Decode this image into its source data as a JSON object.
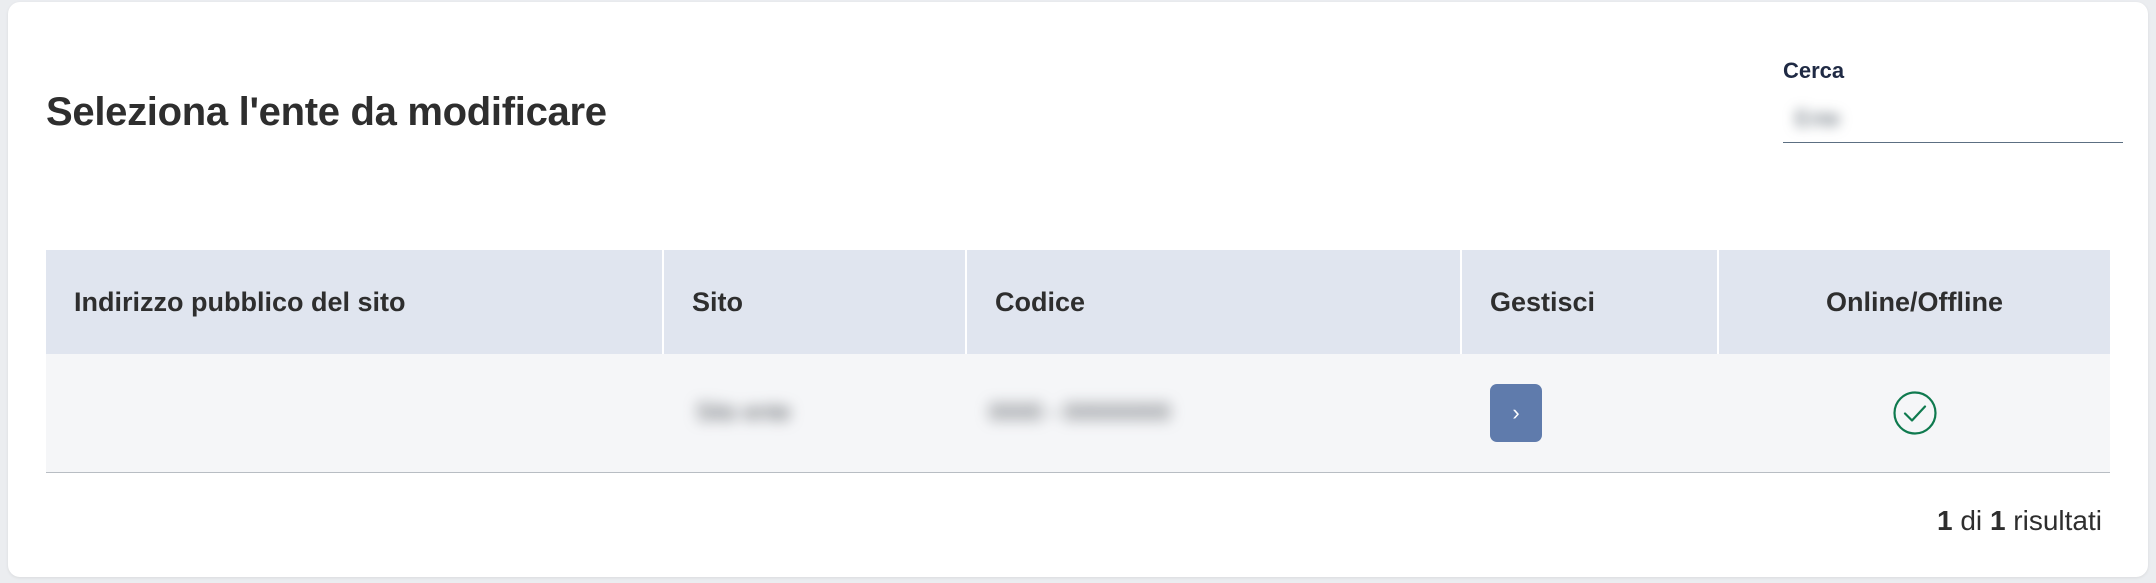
{
  "page": {
    "title": "Seleziona l'ente da modificare"
  },
  "search": {
    "label": "Cerca",
    "value": "Ente"
  },
  "table": {
    "columns": [
      "Indirizzo pubblico del sito",
      "Sito",
      "Codice",
      "Gestisci",
      "Online/Offline"
    ],
    "rows": [
      {
        "address": "",
        "site": "Sito ente",
        "code": "0000 - 00000000",
        "manage_icon": "chevron-right-icon",
        "status": "online",
        "status_icon": "check-circle-icon"
      }
    ]
  },
  "pagination": {
    "shown": "1",
    "separator": "di",
    "total": "1",
    "suffix": "risultati"
  },
  "colors": {
    "header_bg": "#e0e5ef",
    "button_bg": "#5f7bac",
    "online_green": "#0f7a4f"
  }
}
